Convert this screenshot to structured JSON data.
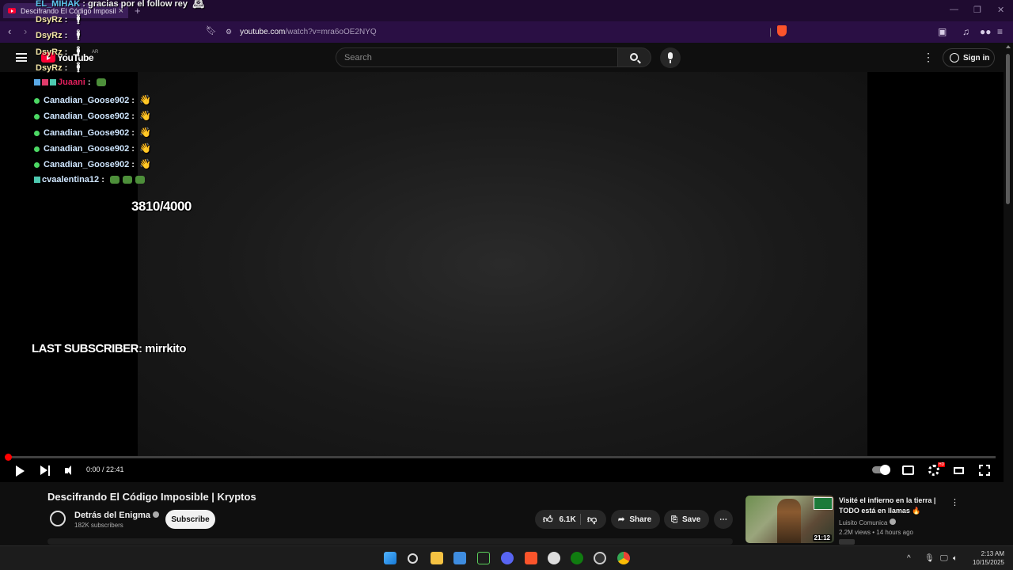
{
  "browser": {
    "tab_title": "Descifrando El Código Imposible",
    "url_host": "youtube.com",
    "url_path": "/watch?v=mra6oOE2NYQ"
  },
  "masthead": {
    "logo_text": "YouTube",
    "country_code": "AR",
    "search_placeholder": "Search",
    "signin_label": "Sign in"
  },
  "overlay": {
    "top_message": {
      "user": "EL_MIHAK",
      "text": "gracias por el follow rey"
    },
    "chat": [
      {
        "user": "DsyRz",
        "kind": "dsy"
      },
      {
        "user": "DsyRz",
        "kind": "dsy"
      },
      {
        "user": "DsyRz",
        "kind": "dsy"
      },
      {
        "user": "DsyRz",
        "kind": "dsy"
      },
      {
        "user": "Juaani",
        "kind": "juaani"
      },
      {
        "user": "Canadian_Goose902",
        "kind": "goose"
      },
      {
        "user": "Canadian_Goose902",
        "kind": "goose"
      },
      {
        "user": "Canadian_Goose902",
        "kind": "goose"
      },
      {
        "user": "Canadian_Goose902",
        "kind": "goose"
      },
      {
        "user": "Canadian_Goose902",
        "kind": "goose"
      },
      {
        "user": "cvaalentina12",
        "kind": "valentina"
      }
    ],
    "goal": "3810/4000",
    "last_subscriber": "LAST SUBSCRIBER: mirrkito"
  },
  "player": {
    "time": "0:00 / 22:41",
    "progress_fraction": 0.0,
    "hd_badge": "HD"
  },
  "video": {
    "title": "Descifrando El Código Imposible | Kryptos",
    "channel": "Detrás del Enigma",
    "subscribers": "182K subscribers",
    "subscribe_label": "Subscribe",
    "like_count": "6.1K",
    "share_label": "Share",
    "save_label": "Save"
  },
  "recommendation": {
    "title": "Visité el infierno en la tierra | TODO está en llamas 🔥",
    "channel": "Luisito Comunica",
    "meta": "2.2M views • 14 hours ago",
    "duration": "21:12"
  },
  "taskbar": {
    "time": "2:13 AM",
    "date": "10/15/2025"
  },
  "colors": {
    "brand_red": "#ff0033",
    "chrome_purple": "#2a0f44"
  }
}
